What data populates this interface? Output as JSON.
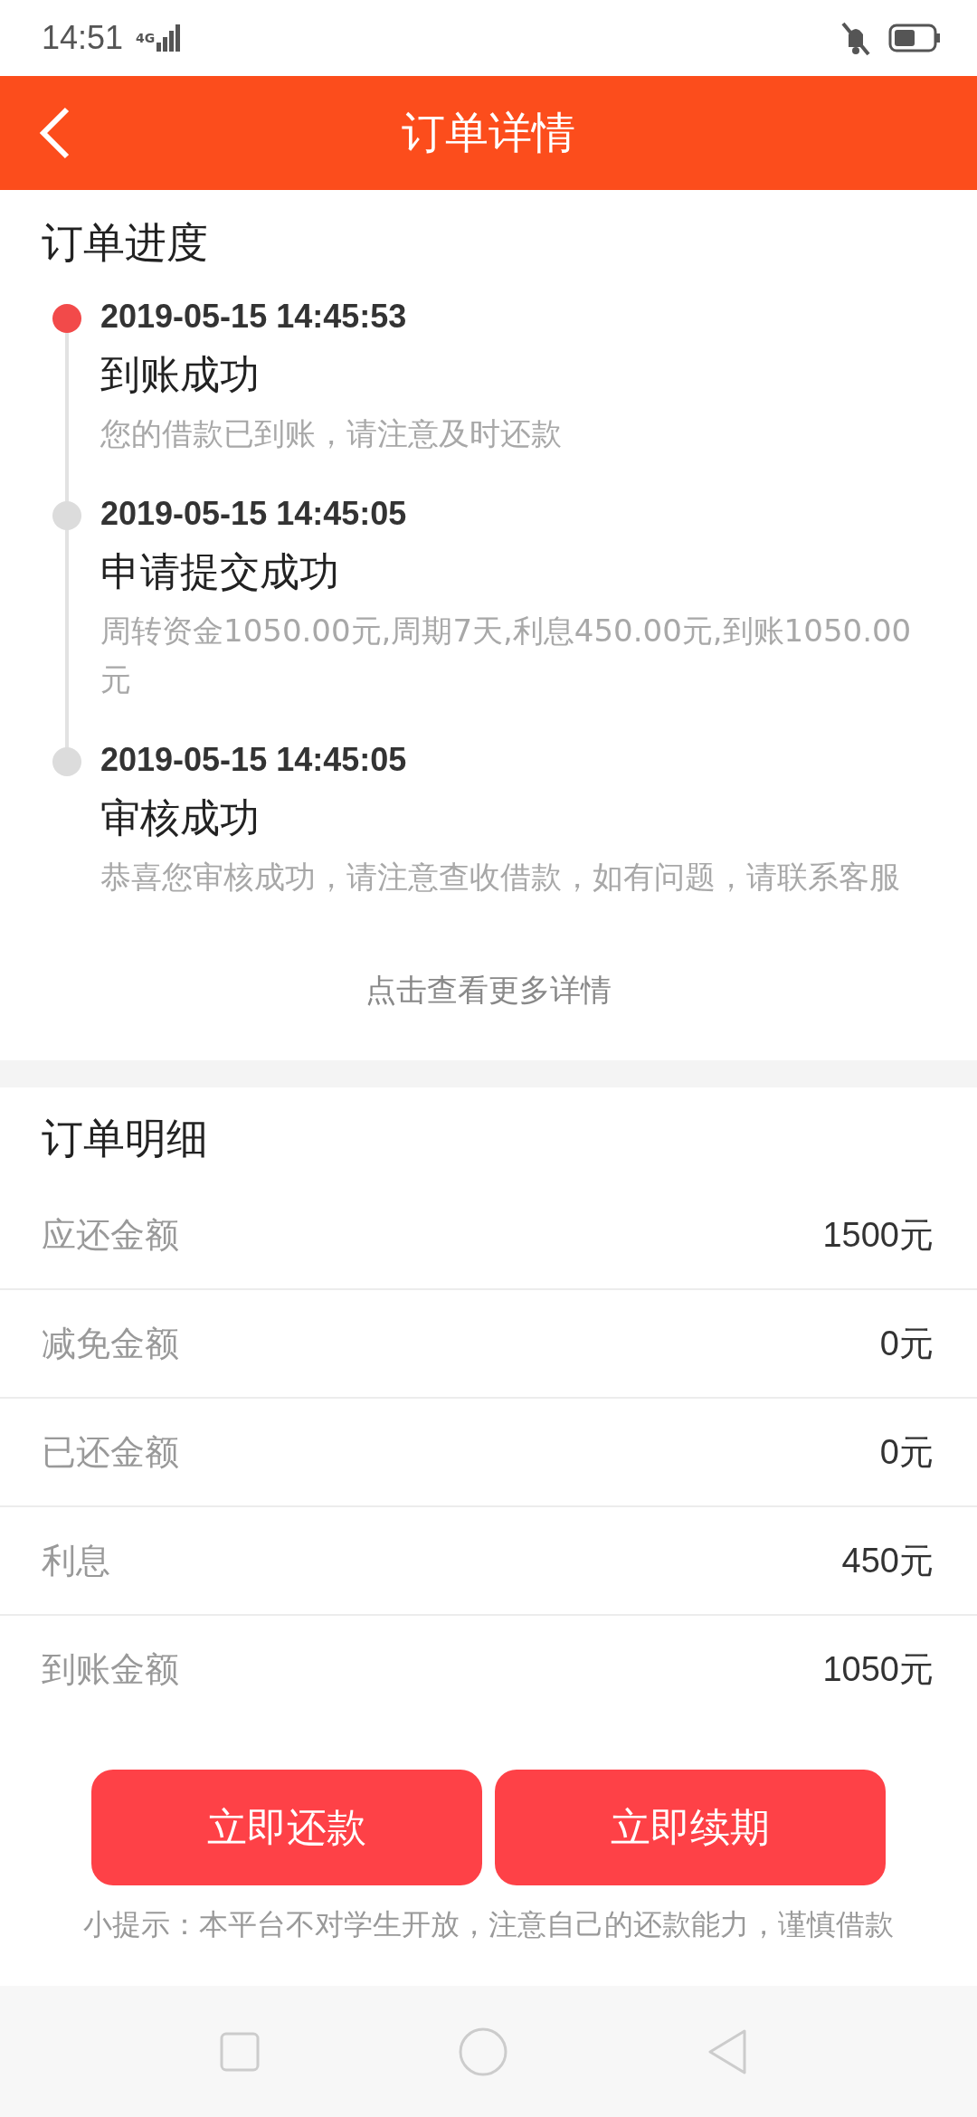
{
  "status_bar": {
    "time": "14:51",
    "network": "4G"
  },
  "header": {
    "title": "订单详情"
  },
  "progress": {
    "title": "订单进度",
    "events": [
      {
        "time": "2019-05-15 14:45:53",
        "title": "到账成功",
        "description": "您的借款已到账，请注意及时还款",
        "active": true
      },
      {
        "time": "2019-05-15 14:45:05",
        "title": "申请提交成功",
        "description": "周转资金1050.00元,周期7天,利息450.00元,到账1050.00元",
        "active": false
      },
      {
        "time": "2019-05-15 14:45:05",
        "title": "审核成功",
        "description": "恭喜您审核成功，请注意查收借款，如有问题，请联系客服",
        "active": false
      }
    ],
    "more_link": "点击查看更多详情"
  },
  "details": {
    "title": "订单明细",
    "rows": [
      {
        "label": "应还金额",
        "value": "1500元"
      },
      {
        "label": "减免金额",
        "value": "0元"
      },
      {
        "label": "已还金额",
        "value": "0元"
      },
      {
        "label": "利息",
        "value": "450元"
      },
      {
        "label": "到账金额",
        "value": "1050元"
      }
    ]
  },
  "buttons": [
    "立即还款",
    "立即续期"
  ],
  "tip": "小提示：本平台不对学生开放，注意自己的还款能力，谨慎借款"
}
